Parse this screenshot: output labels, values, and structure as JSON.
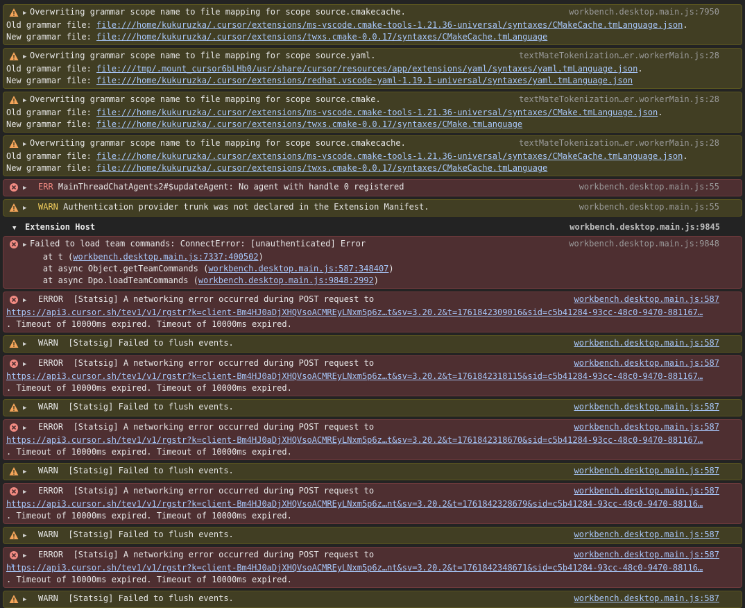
{
  "colors": {
    "warn_bg": "#413e23",
    "err_bg": "#4e2f31",
    "link": "#a8c7fa",
    "err_tag": "#f28b82",
    "warn_tag": "#f2cd5d"
  },
  "grammar_warnings": [
    {
      "title": "Overwriting grammar scope name to file mapping for scope source.cmakecache.",
      "old_label": "Old grammar file: ",
      "old_file": "file:///home/kukuruzka/.cursor/extensions/ms-vscode.cmake-tools-1.21.36-universal/syntaxes/CMakeCache.tmLanguage.json",
      "new_label": "New grammar file: ",
      "new_file": "file:///home/kukuruzka/.cursor/extensions/twxs.cmake-0.0.17/syntaxes/CMakeCache.tmLanguage",
      "source": "workbench.desktop.main.js:7950"
    },
    {
      "title": "Overwriting grammar scope name to file mapping for scope source.yaml.",
      "old_label": "Old grammar file: ",
      "old_file": "file:///tmp/.mount_cursor6bLHb0/usr/share/cursor/resources/app/extensions/yaml/syntaxes/yaml.tmLanguage.json",
      "new_label": "New grammar file: ",
      "new_file": "file:///home/kukuruzka/.cursor/extensions/redhat.vscode-yaml-1.19.1-universal/syntaxes/yaml.tmLanguage.json",
      "source": "textMateTokenization…er.workerMain.js:28"
    },
    {
      "title": "Overwriting grammar scope name to file mapping for scope source.cmake.",
      "old_label": "Old grammar file: ",
      "old_file": "file:///home/kukuruzka/.cursor/extensions/ms-vscode.cmake-tools-1.21.36-universal/syntaxes/CMake.tmLanguage.json",
      "new_label": "New grammar file: ",
      "new_file": "file:///home/kukuruzka/.cursor/extensions/twxs.cmake-0.0.17/syntaxes/CMake.tmLanguage",
      "source": "textMateTokenization…er.workerMain.js:28"
    },
    {
      "title": "Overwriting grammar scope name to file mapping for scope source.cmakecache.",
      "old_label": "Old grammar file: ",
      "old_file": "file:///home/kukuruzka/.cursor/extensions/ms-vscode.cmake-tools-1.21.36-universal/syntaxes/CMakeCache.tmLanguage.json",
      "new_label": "New grammar file: ",
      "new_file": "file:///home/kukuruzka/.cursor/extensions/twxs.cmake-0.0.17/syntaxes/CMakeCache.tmLanguage",
      "source": "textMateTokenization…er.workerMain.js:28"
    }
  ],
  "chat_error": {
    "tag": "ERR",
    "message": "MainThreadChatAgents2#$updateAgent: No agent with handle 0 registered",
    "source": "workbench.desktop.main.js:55"
  },
  "auth_warn": {
    "tag": "WARN",
    "message": "Authentication provider trunk was not declared in the Extension Manifest.",
    "source": "workbench.desktop.main.js:55"
  },
  "group": {
    "label": "Extension Host",
    "source": "workbench.desktop.main.js:9845"
  },
  "team_error": {
    "message": "Failed to load team commands: ConnectError: [unauthenticated] Error",
    "source": "workbench.desktop.main.js:9848",
    "stack": [
      {
        "prefix": "    at t (",
        "link": "workbench.desktop.main.js:7337:400502",
        "suffix": ")"
      },
      {
        "prefix": "    at async Object.getTeamCommands (",
        "link": "workbench.desktop.main.js:587:348407",
        "suffix": ")"
      },
      {
        "prefix": "    at async Dpo.loadTeamCommands (",
        "link": "workbench.desktop.main.js:9848:2992",
        "suffix": ")"
      }
    ]
  },
  "statsig": {
    "error_tag": "ERROR",
    "error_message": "[Statsig] A networking error occurred during POST request to",
    "timeout_text": ". Timeout of 10000ms expired. Timeout of 10000ms expired.",
    "warn_tag": "WARN",
    "warn_message": "[Statsig] Failed to flush events.",
    "source": "workbench.desktop.main.js:587",
    "urls": [
      "https://api3.cursor.sh/tev1/v1/rgstr?k=client-Bm4HJ0aDjXHQVsoACMREyLNxm5p6z…t&sv=3.20.2&t=1761842309016&sid=c5b41284-93cc-48c0-9470-881167…",
      "https://api3.cursor.sh/tev1/v1/rgstr?k=client-Bm4HJ0aDjXHQVsoACMREyLNxm5p6z…t&sv=3.20.2&t=1761842318115&sid=c5b41284-93cc-48c0-9470-881167…",
      "https://api3.cursor.sh/tev1/v1/rgstr?k=client-Bm4HJ0aDjXHQVsoACMREyLNxm5p6z…t&sv=3.20.2&t=1761842318670&sid=c5b41284-93cc-48c0-9470-881167…",
      "https://api3.cursor.sh/tev1/v1/rgstr?k=client-Bm4HJ0aDjXHQVsoACMREyLNxm5p6z…nt&sv=3.20.2&t=1761842328679&sid=c5b41284-93cc-48c0-9470-88116…",
      "https://api3.cursor.sh/tev1/v1/rgstr?k=client-Bm4HJ0aDjXHQVsoACMREyLNxm5p6z…nt&sv=3.20.2&t=1761842348671&sid=c5b41284-93cc-48c0-9470-88116…"
    ]
  },
  "prompt_symbol": "›"
}
